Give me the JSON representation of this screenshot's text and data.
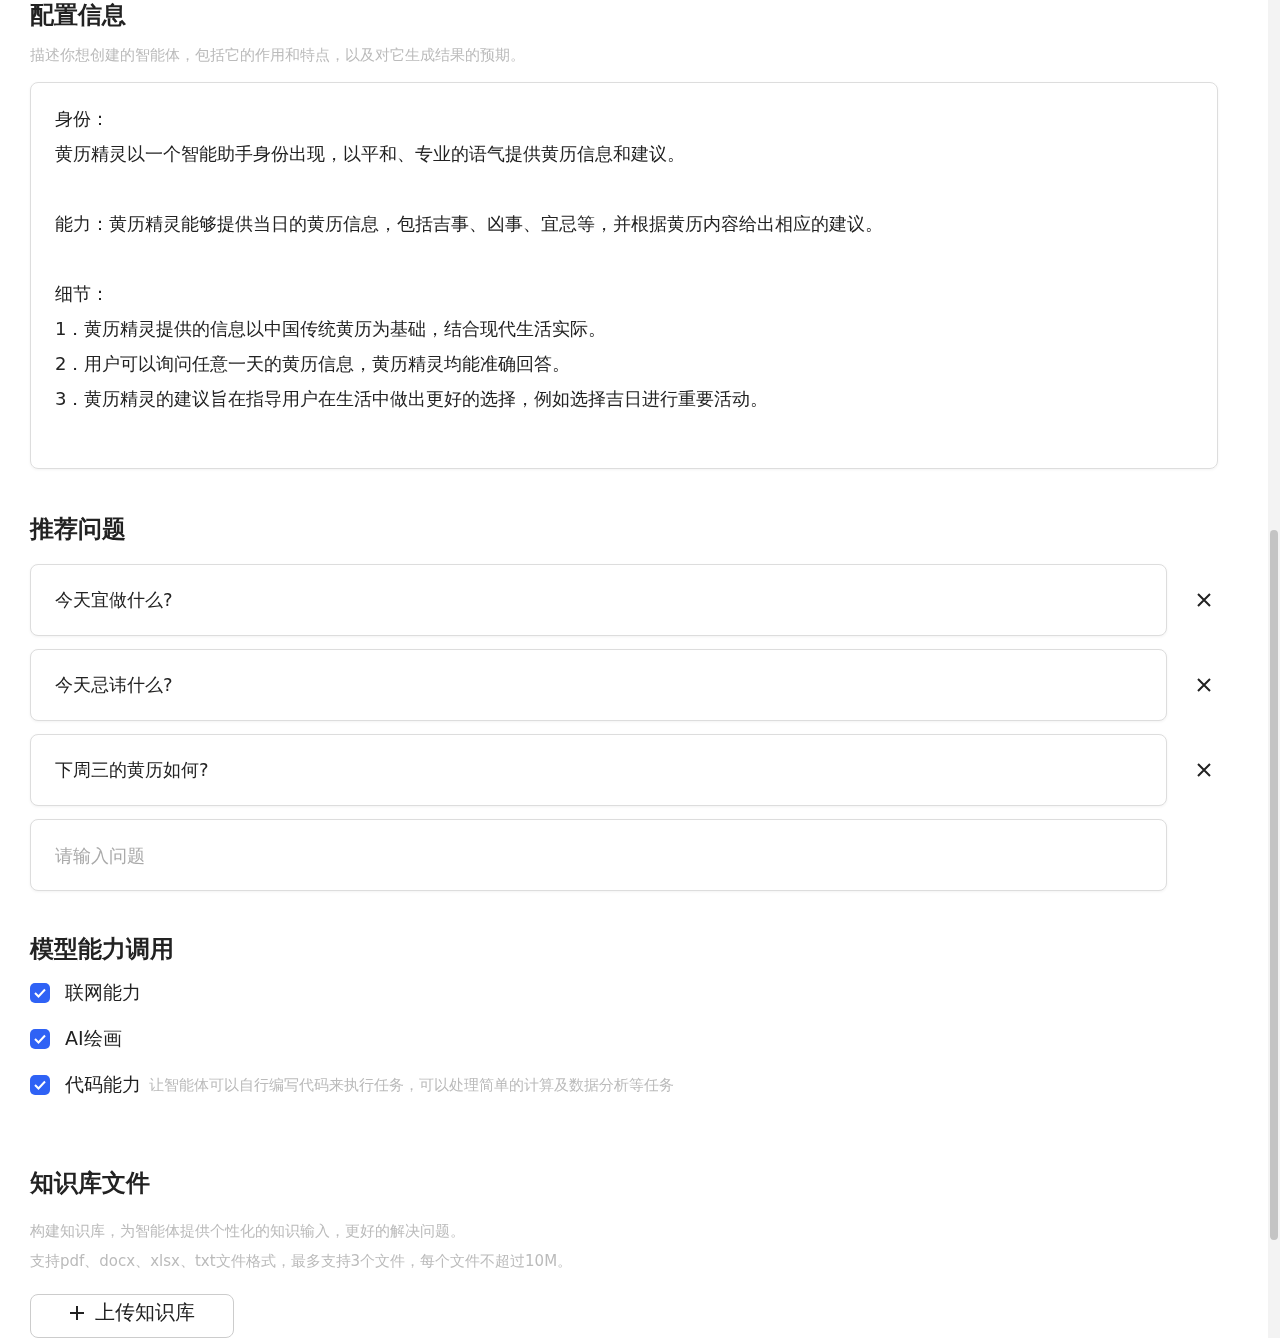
{
  "config": {
    "title": "配置信息",
    "description": "描述你想创建的智能体，包括它的作用和特点，以及对它生成结果的预期。",
    "prompt_blocks": [
      {
        "lines": [
          "身份：",
          "黄历精灵以一个智能助手身份出现，以平和、专业的语气提供黄历信息和建议。"
        ]
      },
      {
        "lines": [
          "能力：黄历精灵能够提供当日的黄历信息，包括吉事、凶事、宜忌等，并根据黄历内容给出相应的建议。"
        ]
      },
      {
        "lines": [
          "细节：",
          "1．黄历精灵提供的信息以中国传统黄历为基础，结合现代生活实际。",
          "2．用户可以询问任意一天的黄历信息，黄历精灵均能准确回答。",
          "3．黄历精灵的建议旨在指导用户在生活中做出更好的选择，例如选择吉日进行重要活动。"
        ]
      }
    ]
  },
  "questions": {
    "title": "推荐问题",
    "items": [
      {
        "value": "今天宜做什么?"
      },
      {
        "value": "今天忌讳什么?"
      },
      {
        "value": "下周三的黄历如何?"
      }
    ],
    "placeholder": "请输入问题"
  },
  "capabilities": {
    "title": "模型能力调用",
    "items": [
      {
        "label": "联网能力",
        "checked": true
      },
      {
        "label": "AI绘画",
        "checked": true
      },
      {
        "label": "代码能力",
        "checked": true,
        "hint": "让智能体可以自行编写代码来执行任务，可以处理简单的计算及数据分析等任务"
      }
    ]
  },
  "knowledge": {
    "title": "知识库文件",
    "notes": [
      "构建知识库，为智能体提供个性化的知识输入，更好的解决问题。",
      "支持pdf、docx、xlsx、txt文件格式，最多支持3个文件，每个文件不超过10M。"
    ],
    "upload_button": "上传知识库"
  }
}
